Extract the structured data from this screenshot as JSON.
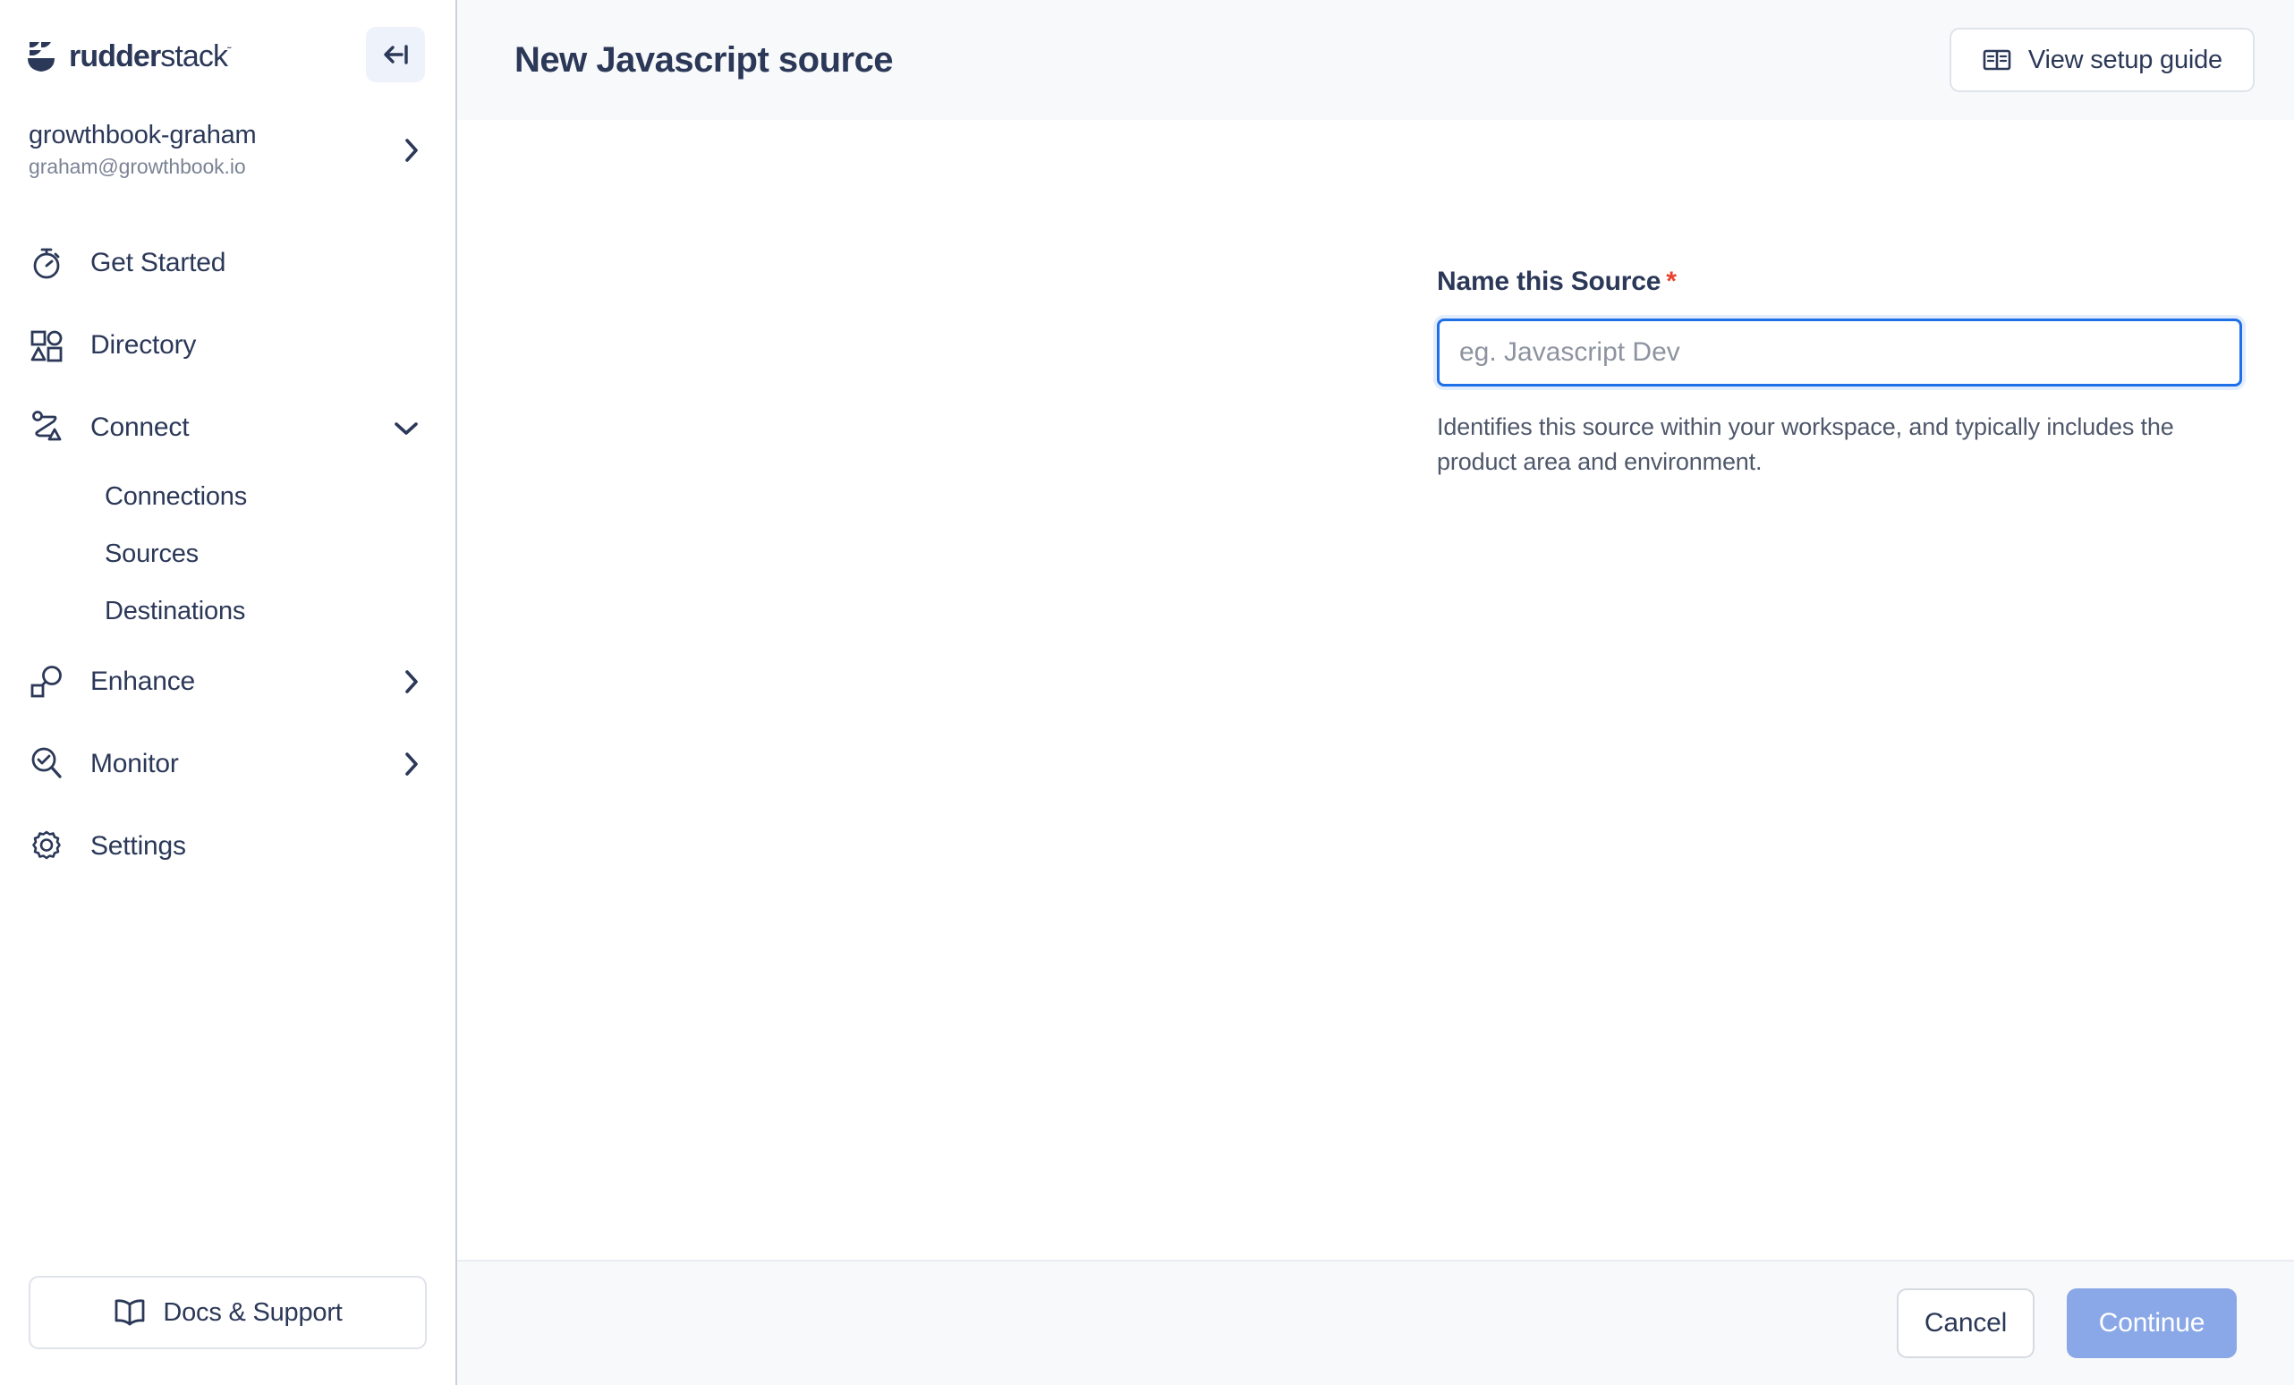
{
  "brand": {
    "logo_text_bold": "rudder",
    "logo_text_light": "stack",
    "trademark": "˜",
    "navy": "#2b3858",
    "accent_blue": "#1e6fe8",
    "required_red": "#e8422f",
    "continue_blue": "#8aa8e8"
  },
  "sidebar": {
    "collapse_icon": "arrow-left-to-line-icon",
    "workspace": {
      "name": "growthbook-graham",
      "email": "graham@growthbook.io",
      "chevron": "chevron-right-icon"
    },
    "nav": [
      {
        "label": "Get Started",
        "icon": "stopwatch-icon",
        "chevron": ""
      },
      {
        "label": "Directory",
        "icon": "directory-shapes-icon",
        "chevron": ""
      },
      {
        "label": "Connect",
        "icon": "connect-path-icon",
        "chevron": "chevron-down-icon"
      },
      {
        "label": "Enhance",
        "icon": "enhance-node-icon",
        "chevron": "chevron-right-icon"
      },
      {
        "label": "Monitor",
        "icon": "magnifier-check-icon",
        "chevron": "chevron-right-icon"
      },
      {
        "label": "Settings",
        "icon": "gear-icon",
        "chevron": ""
      }
    ],
    "connect_submenu": [
      {
        "label": "Connections"
      },
      {
        "label": "Sources"
      },
      {
        "label": "Destinations"
      }
    ],
    "docs_button": {
      "label": "Docs & Support",
      "icon": "open-book-icon"
    }
  },
  "header": {
    "title": "New Javascript source",
    "setup_guide": {
      "label": "View setup guide",
      "icon": "book-open-icon"
    }
  },
  "form": {
    "name_field": {
      "label": "Name this Source",
      "required_marker": "*",
      "value": "",
      "placeholder": "eg. Javascript Dev",
      "help_text": "Identifies this source within your workspace, and typically includes the product area and environment."
    }
  },
  "footer": {
    "cancel_label": "Cancel",
    "continue_label": "Continue"
  }
}
